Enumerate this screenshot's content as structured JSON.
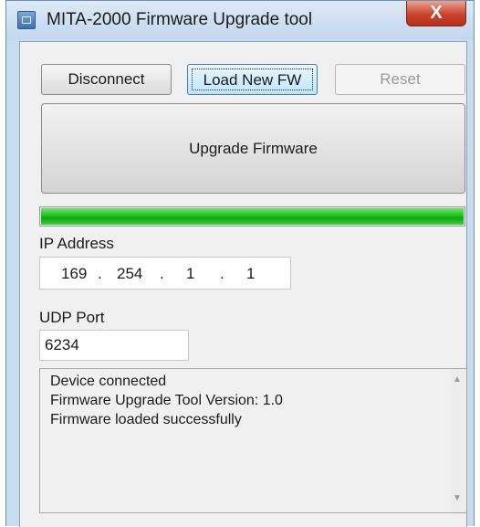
{
  "window": {
    "title": "MITA-2000 Firmware Upgrade tool",
    "close_symbol": "X"
  },
  "buttons": {
    "disconnect": "Disconnect",
    "load_fw": "Load New FW",
    "reset": "Reset",
    "upgrade": "Upgrade Firmware"
  },
  "progress": {
    "fraction": 1.0,
    "color": "#22c022"
  },
  "ip": {
    "label": "IP Address",
    "octets": [
      "169",
      "254",
      "1",
      "1"
    ]
  },
  "udp": {
    "label": "UDP Port",
    "value": "6234"
  },
  "log": {
    "lines": [
      "Device connected",
      "Firmware Upgrade Tool Version: 1.0",
      "Firmware loaded successfully"
    ]
  },
  "scroll": {
    "up": "▲",
    "down": "▼"
  },
  "icons": {
    "app": "app-window-icon",
    "close": "close-icon"
  }
}
